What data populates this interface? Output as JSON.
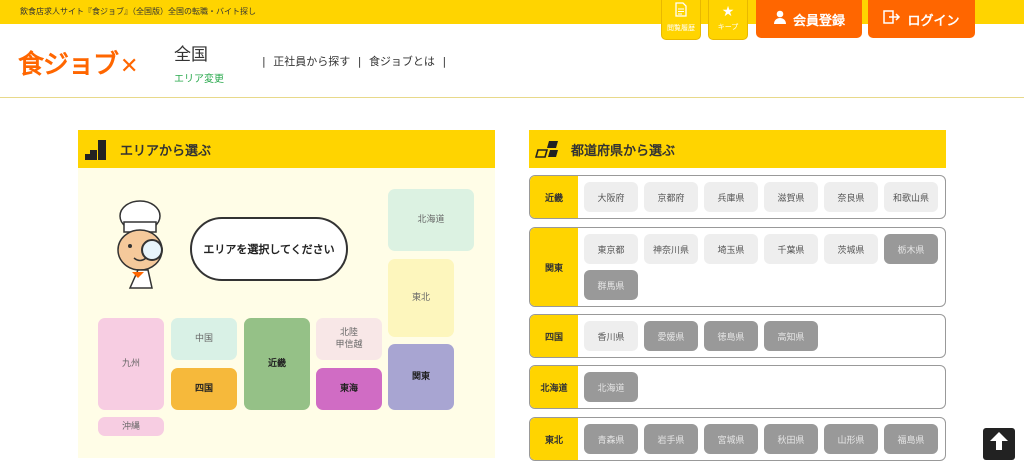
{
  "topbar": {
    "tagline": "飲食店求人サイト『食ジョブ』（全国版）全国の転職・バイト探し"
  },
  "header_icons": {
    "history": {
      "label": "閲覧履歴",
      "icon": "document-icon"
    },
    "keep": {
      "label": "キープ",
      "icon": "star-icon"
    }
  },
  "header_buttons": {
    "register": {
      "label": "会員登録",
      "icon": "person-icon",
      "color": "#ff6600"
    },
    "login": {
      "label": "ログイン",
      "icon": "login-icon",
      "color": "#ff6600"
    }
  },
  "header": {
    "logo": "食ジョブ",
    "region": "全国",
    "region_change": "エリア変更",
    "nav": [
      "正社員から探す",
      "食ジョブとは"
    ]
  },
  "area_section": {
    "title": "エリアから選ぶ",
    "bubble": "エリアを選択してください",
    "regions": {
      "hokkaido": "北海道",
      "tohoku": "東北",
      "kyushu": "九州",
      "chugoku": "中国",
      "kinki": "近畿",
      "hokuriku": "北陸\n甲信越",
      "shikoku": "四国",
      "tokai": "東海",
      "kanto": "関東",
      "okinawa": "沖縄"
    }
  },
  "pref_section": {
    "title": "都道府県から選ぶ",
    "rows": [
      {
        "label": "近畿",
        "items": [
          {
            "name": "大阪府",
            "active": true
          },
          {
            "name": "京都府",
            "active": true
          },
          {
            "name": "兵庫県",
            "active": true
          },
          {
            "name": "滋賀県",
            "active": true
          },
          {
            "name": "奈良県",
            "active": true
          },
          {
            "name": "和歌山県",
            "active": true
          }
        ]
      },
      {
        "label": "関東",
        "items": [
          {
            "name": "東京都",
            "active": true
          },
          {
            "name": "神奈川県",
            "active": true
          },
          {
            "name": "埼玉県",
            "active": true
          },
          {
            "name": "千葉県",
            "active": true
          },
          {
            "name": "茨城県",
            "active": true
          },
          {
            "name": "栃木県",
            "active": false
          },
          {
            "name": "群馬県",
            "active": false
          }
        ]
      },
      {
        "label": "四国",
        "items": [
          {
            "name": "香川県",
            "active": true
          },
          {
            "name": "愛媛県",
            "active": false
          },
          {
            "name": "徳島県",
            "active": false
          },
          {
            "name": "高知県",
            "active": false
          }
        ]
      },
      {
        "label": "北海道",
        "items": [
          {
            "name": "北海道",
            "active": false
          }
        ]
      },
      {
        "label": "東北",
        "items": [
          {
            "name": "青森県",
            "active": false
          },
          {
            "name": "岩手県",
            "active": false
          },
          {
            "name": "宮城県",
            "active": false
          },
          {
            "name": "秋田県",
            "active": false
          },
          {
            "name": "山形県",
            "active": false
          },
          {
            "name": "福島県",
            "active": false
          }
        ]
      }
    ]
  },
  "colors": {
    "brand_yellow": "#ffd400",
    "brand_orange": "#ff6600"
  },
  "back_to_top_icon": "arrow-up-icon"
}
